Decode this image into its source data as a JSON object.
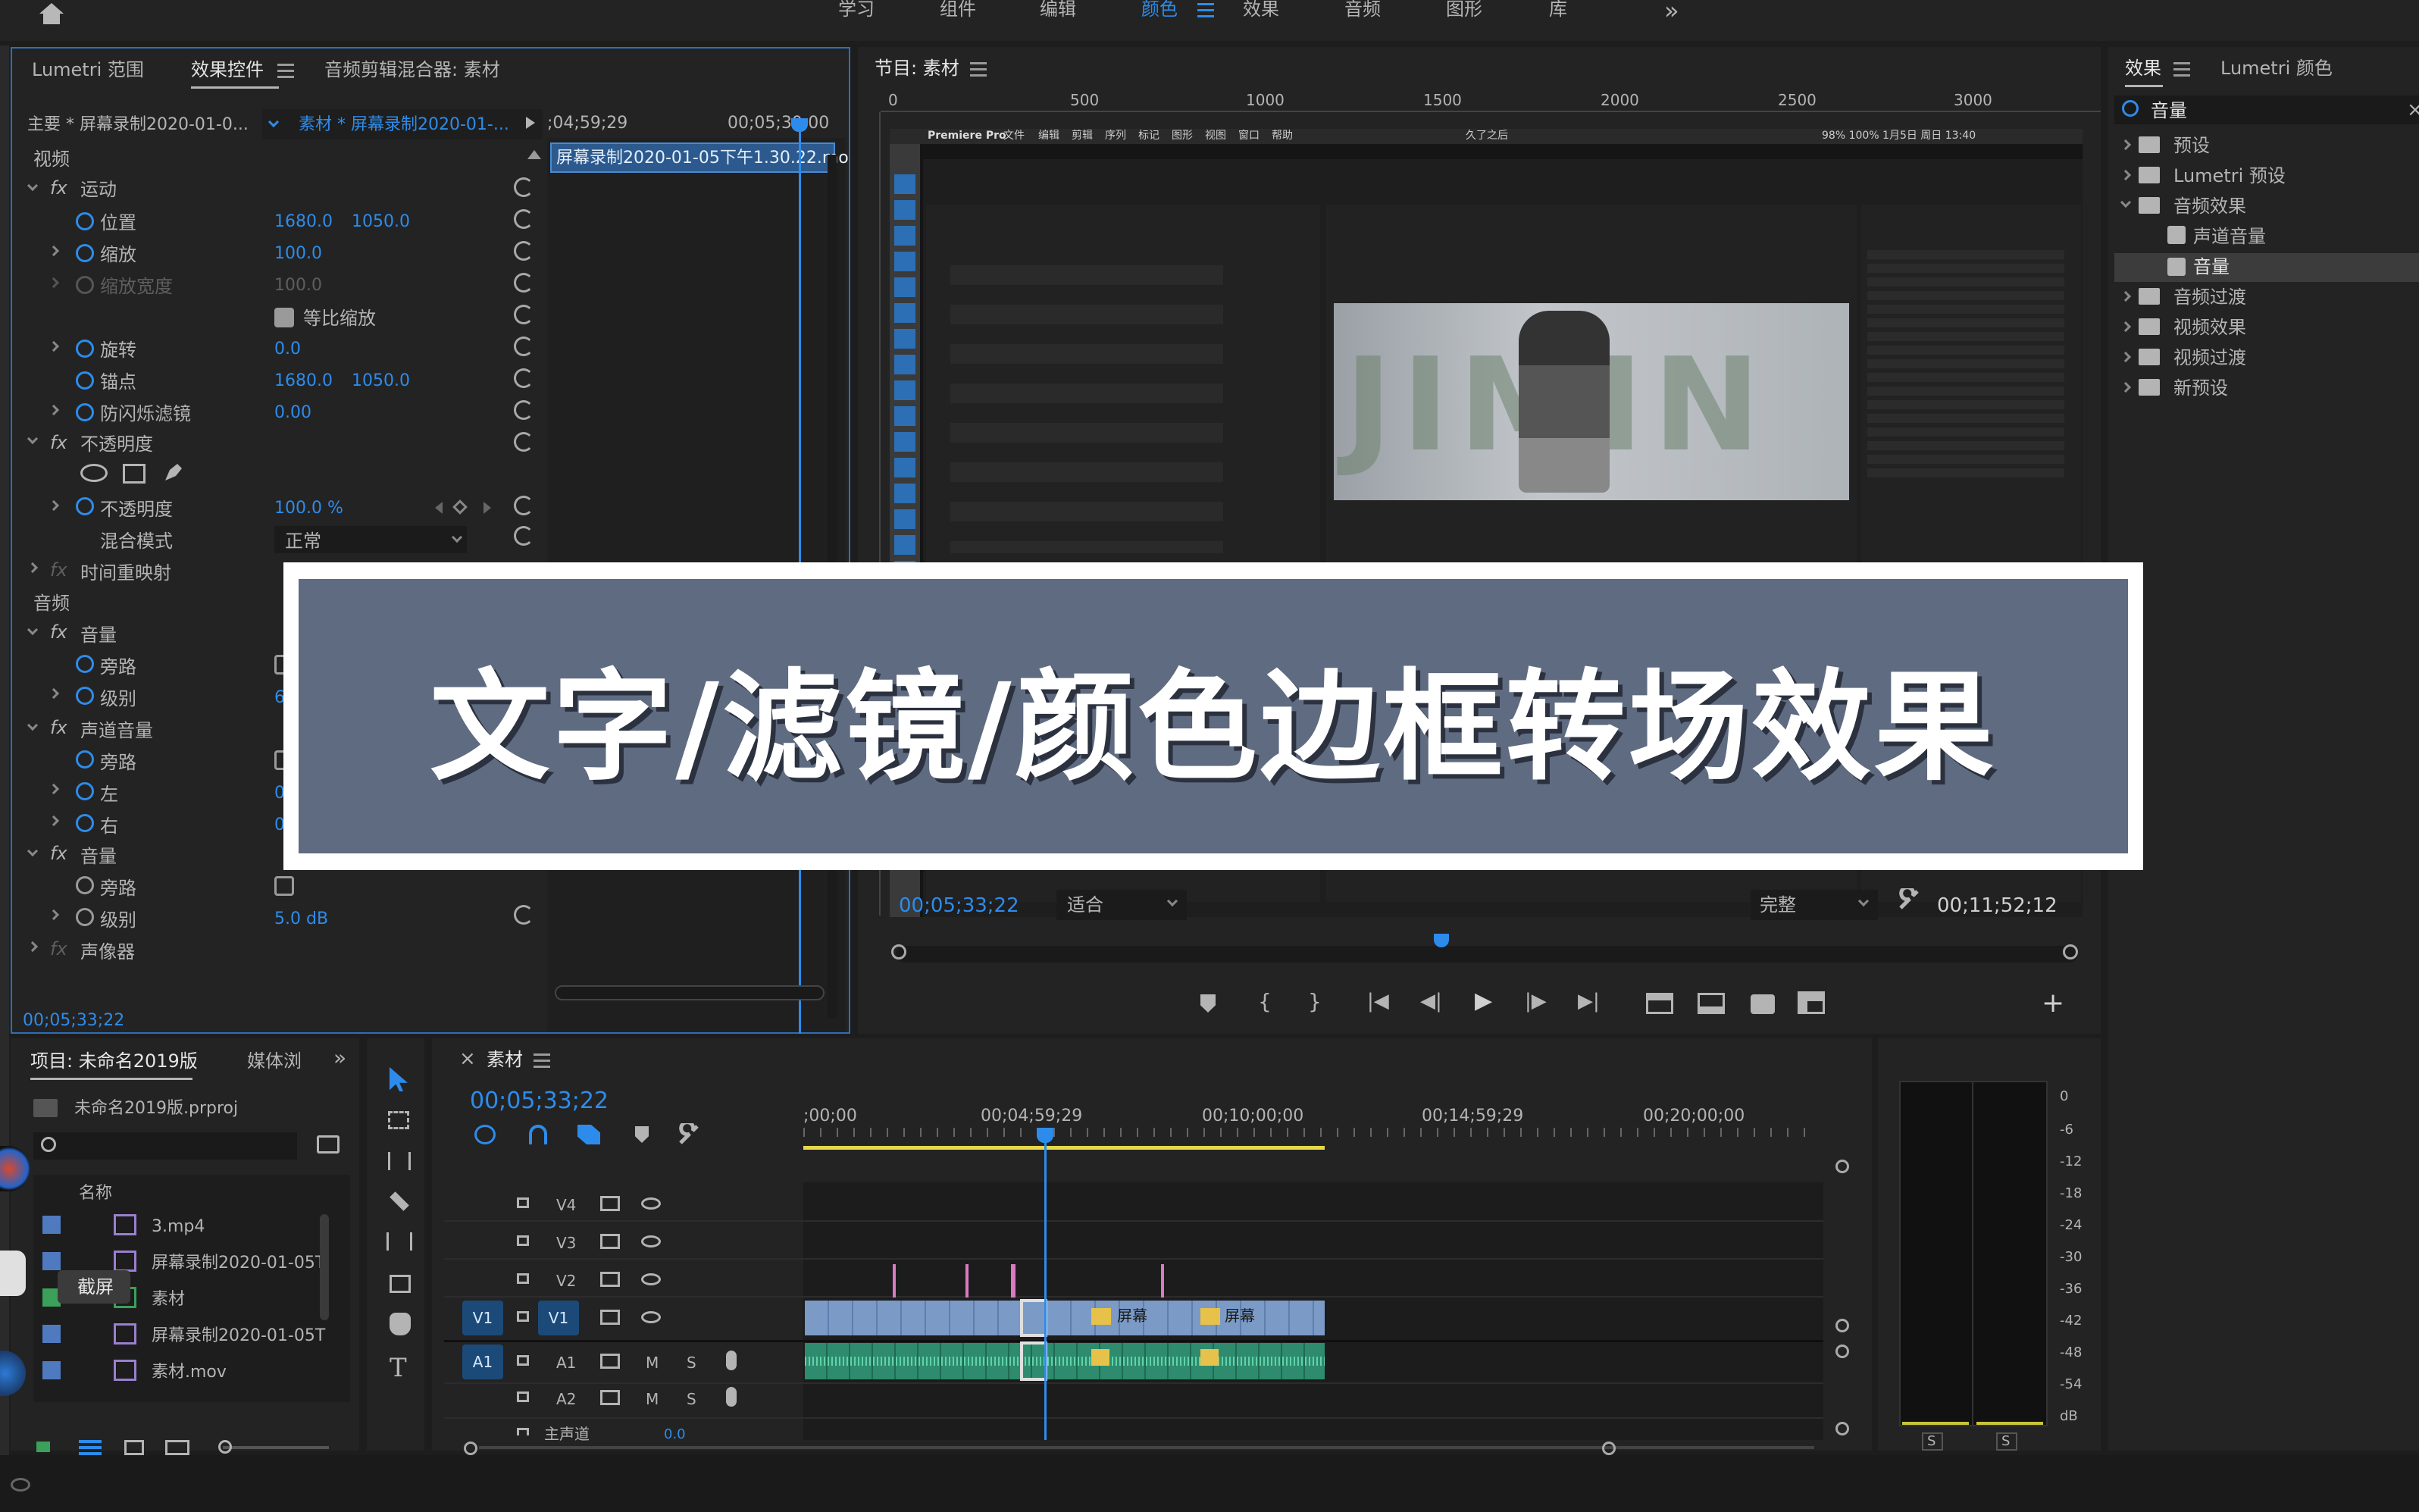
{
  "workspace_tabs": [
    "学习",
    "组件",
    "编辑",
    "颜色",
    "效果",
    "音频",
    "图形",
    "库"
  ],
  "workspace_active": "颜色",
  "more_glyph": "»",
  "effect_controls": {
    "tabs": [
      "Lumetri 范围",
      "效果控件",
      "音频剪辑混合器: 素材"
    ],
    "master_label": "主要 * 屏幕录制2020-01-0...",
    "clip_label": "素材 * 屏幕录制2020-01-...",
    "ruler_times": [
      ";04;59;29",
      "00;05;30;00"
    ],
    "clip_bar": "屏幕录制2020-01-05下午1.30.22.mo",
    "sections": {
      "video": "视频",
      "motion": "运动",
      "position": "位置",
      "position_x": "1680.0",
      "position_y": "1050.0",
      "scale": "缩放",
      "scale_v": "100.0",
      "scale_width": "缩放宽度",
      "scale_width_v": "100.0",
      "uniform": "等比缩放",
      "rotation": "旋转",
      "rotation_v": "0.0",
      "anchor": "锚点",
      "anchor_x": "1680.0",
      "anchor_y": "1050.0",
      "antiflicker": "防闪烁滤镜",
      "antiflicker_v": "0.00",
      "opacity_group": "不透明度",
      "opacity": "不透明度",
      "opacity_v": "100.0 %",
      "blend": "混合模式",
      "blend_v": "正常",
      "time_remap": "时间重映射",
      "audio": "音频",
      "volume": "音量",
      "bypass": "旁路",
      "level": "级别",
      "level_v1": "6",
      "channel_volume": "声道音量",
      "bypass2": "旁路",
      "left": "左",
      "left_v": "0",
      "right": "右",
      "right_v": "0",
      "volume2": "音量",
      "bypass3": "旁路",
      "level2": "级别",
      "level2_v": "5.0 dB",
      "panner": "声像器"
    },
    "timecode": "00;05;33;22"
  },
  "program": {
    "title": "节目: 素材",
    "ruler": [
      "0",
      "500",
      "1000",
      "1500",
      "2000",
      "2500",
      "3000"
    ],
    "timecode": "00;05;33;22",
    "fit": "适合",
    "quality": "完整",
    "duration": "00;11;52;12"
  },
  "inner_shot": {
    "menubar": [
      "Premiere Pro",
      "文件",
      "编辑",
      "剪辑",
      "序列",
      "标记",
      "图形",
      "视图",
      "窗口",
      "帮助"
    ],
    "status": "98%  100%  1月5日 周日 13:40",
    "window_title": "久了之后",
    "watermark": "JIMIN"
  },
  "effects_panel": {
    "tabs": [
      "效果",
      "Lumetri 颜色"
    ],
    "search_value": "音量",
    "tree": [
      {
        "label": "预设",
        "level": 0,
        "open": false
      },
      {
        "label": "Lumetri 预设",
        "level": 0,
        "open": false
      },
      {
        "label": "音频效果",
        "level": 0,
        "open": true
      },
      {
        "label": "声道音量",
        "level": 1,
        "open": false
      },
      {
        "label": "音量",
        "level": 1,
        "open": false,
        "selected": true
      },
      {
        "label": "音频过渡",
        "level": 0,
        "open": false
      },
      {
        "label": "视频效果",
        "level": 0,
        "open": false
      },
      {
        "label": "视频过渡",
        "level": 0,
        "open": false
      },
      {
        "label": "新预设",
        "level": 0,
        "open": false
      }
    ]
  },
  "project": {
    "tabs": [
      "项目: 未命名2019版",
      "媒体浏"
    ],
    "file": "未命名2019版.prproj",
    "column_name": "名称",
    "items": [
      "3.mp4",
      "屏幕录制2020-01-05T",
      "素材",
      "屏幕录制2020-01-05T",
      "素材.mov"
    ],
    "tooltip": "截屏"
  },
  "timeline": {
    "sequence": "素材",
    "timecode": "00;05;33;22",
    "ruler": [
      ";00;00",
      "00;04;59;29",
      "00;10;00;00",
      "00;14;59;29",
      "00;20;00;00"
    ],
    "tracks_video": [
      "V4",
      "V3",
      "V2",
      "V1"
    ],
    "tracks_audio": [
      "A1",
      "A2"
    ],
    "master": "主声道",
    "master_v": "0.0",
    "src_v": "V1",
    "src_a": "A1",
    "clip_label": "屏幕",
    "m": "M",
    "s": "S"
  },
  "meter": {
    "scale": [
      "0",
      "-6",
      "-12",
      "-18",
      "-24",
      "-30",
      "-36",
      "-42",
      "-48",
      "-54",
      "dB"
    ],
    "solo": [
      "S",
      "S"
    ]
  },
  "overlay_title": "文字/滤镜/颜色边框转场效果"
}
